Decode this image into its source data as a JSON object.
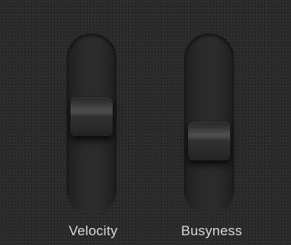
{
  "sliders": [
    {
      "label": "Velocity",
      "level": 0.65
    },
    {
      "label": "Busyness",
      "level": 0.5
    }
  ],
  "colors": {
    "background": "#2a2a2a",
    "label": "#d8d8d8"
  }
}
